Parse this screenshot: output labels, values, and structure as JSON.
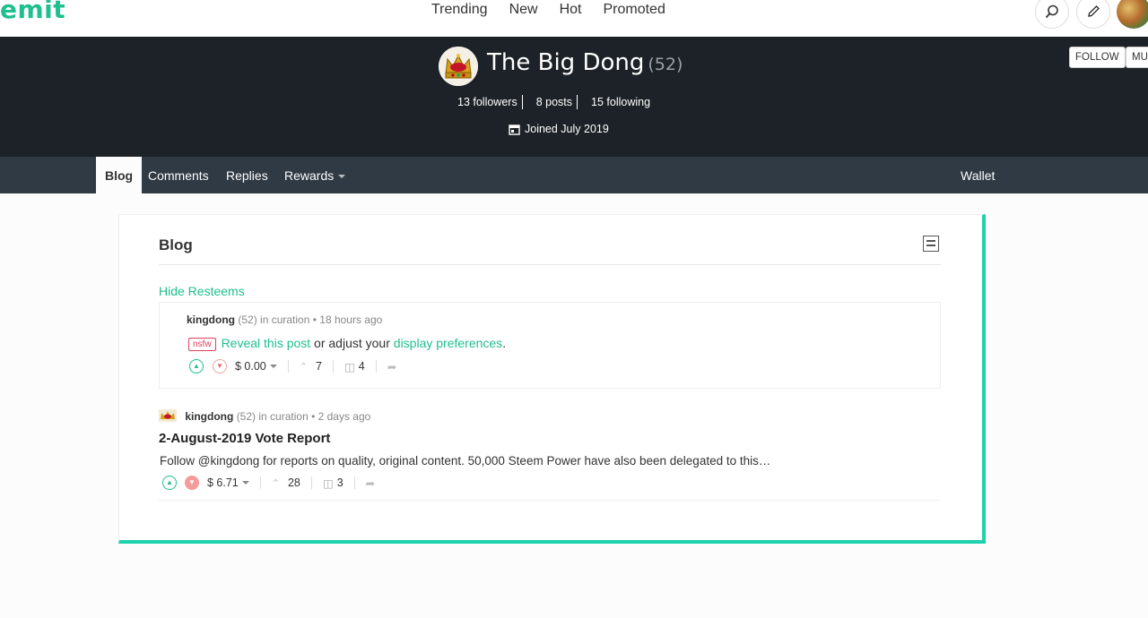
{
  "app": {
    "logo": "emit"
  },
  "nav": {
    "items": [
      "Trending",
      "New",
      "Hot",
      "Promoted"
    ]
  },
  "profile": {
    "name": "The Big Dong",
    "reputation": "(52)",
    "followers": "13 followers",
    "posts": "8 posts",
    "following": "15 following",
    "joined": "Joined July 2019",
    "follow_label": "FOLLOW",
    "mute_label": "MU"
  },
  "tabs": {
    "blog": "Blog",
    "comments": "Comments",
    "replies": "Replies",
    "rewards": "Rewards",
    "wallet": "Wallet"
  },
  "panel": {
    "title": "Blog",
    "hide_resteems": "Hide Resteems"
  },
  "posts": [
    {
      "author": "kingdong",
      "rep": "(52)",
      "meta": "in curation • 18 hours ago",
      "nsfw_tag": "nsfw",
      "reveal": "Reveal this post",
      "mid": " or adjust your ",
      "prefs": "display preferences",
      "end": ".",
      "payout": "$ 0.00",
      "votes": "7",
      "comments": "4"
    },
    {
      "author": "kingdong",
      "rep": "(52)",
      "meta": "in curation • 2 days ago",
      "title": "2-August-2019 Vote Report",
      "excerpt": "Follow @kingdong for reports on quality, original content. 50,000 Steem Power have also been delegated to this…",
      "payout": "$ 6.71",
      "votes": "28",
      "comments": "3"
    }
  ],
  "colors": {
    "accent": "#1fbf8f",
    "hero_bg": "#1c2227",
    "tabbar_bg": "#2f3a44",
    "panel_accent": "#1fd1ac"
  }
}
